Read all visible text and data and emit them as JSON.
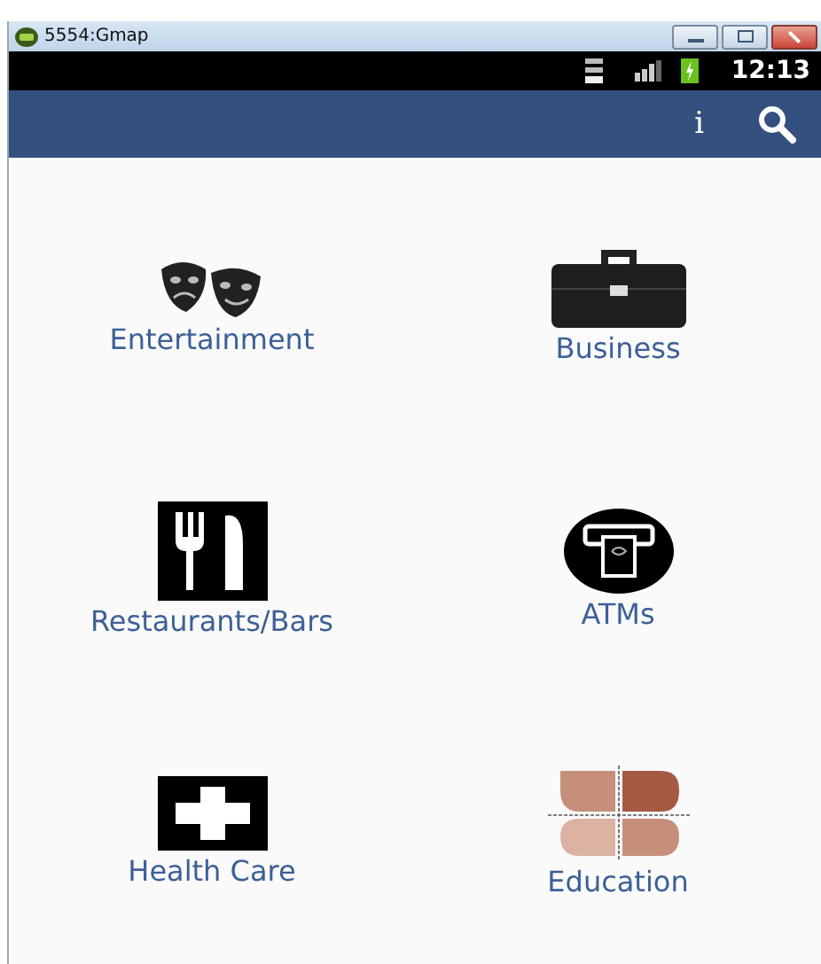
{
  "window": {
    "title": "5554:Gmap"
  },
  "status_bar": {
    "time": "12:13"
  },
  "action_bar": {
    "info": "i"
  },
  "categories": [
    {
      "label": "Entertainment",
      "kind": "masks"
    },
    {
      "label": "Business",
      "kind": "briefcase"
    },
    {
      "label": "Restaurants/Bars",
      "kind": "cutlery"
    },
    {
      "label": "ATMs",
      "kind": "atm"
    },
    {
      "label": "Health Care",
      "kind": "cross"
    },
    {
      "label": "Education",
      "kind": "quadrants"
    }
  ]
}
